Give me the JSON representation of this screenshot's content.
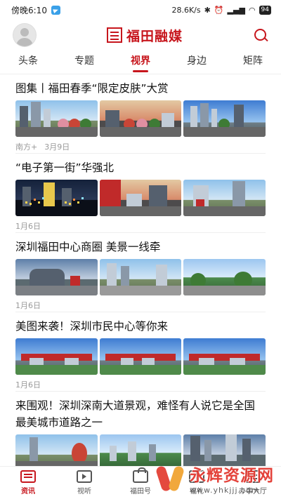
{
  "status_bar": {
    "time": "傍晚6:10",
    "speed": "28.6K/s",
    "icons": [
      "telegram-icon",
      "bluetooth-icon",
      "alarm-icon",
      "signal-icon",
      "wifi-icon"
    ],
    "battery": "94"
  },
  "header": {
    "brand_name": "福田融媒",
    "brand_color": "#c7161d"
  },
  "tabs": [
    {
      "label": "头条",
      "active": false
    },
    {
      "label": "专题",
      "active": false
    },
    {
      "label": "视界",
      "active": true
    },
    {
      "label": "身边",
      "active": false
    },
    {
      "label": "矩阵",
      "active": false
    }
  ],
  "articles": [
    {
      "title": "图集丨福田春季“限定皮肤”大赏",
      "source": "南方+",
      "date": "3月9日"
    },
    {
      "title": "“电子第一街”华强北",
      "source": "",
      "date": "1月6日"
    },
    {
      "title": "深圳福田中心商圈 美景一线牵",
      "source": "",
      "date": "1月6日"
    },
    {
      "title": "美图来袭！深圳市民中心等你来",
      "source": "",
      "date": "1月6日"
    },
    {
      "title": "来围观！深圳深南大道景观，难怪有人说它是全国最美城市道路之一",
      "source": "",
      "date": ""
    }
  ],
  "bottom_nav": [
    {
      "label": "资讯",
      "icon": "news-icon",
      "active": true
    },
    {
      "label": "视听",
      "icon": "tv-icon",
      "active": false
    },
    {
      "label": "福田号",
      "icon": "shop-icon",
      "active": false
    },
    {
      "label": "福礼",
      "icon": "gift-icon",
      "active": false
    },
    {
      "label": "办事大厅",
      "icon": "hall-icon",
      "active": false
    }
  ],
  "watermark": {
    "title": "永辉资源网",
    "url": "www.yhkjjj.com"
  }
}
